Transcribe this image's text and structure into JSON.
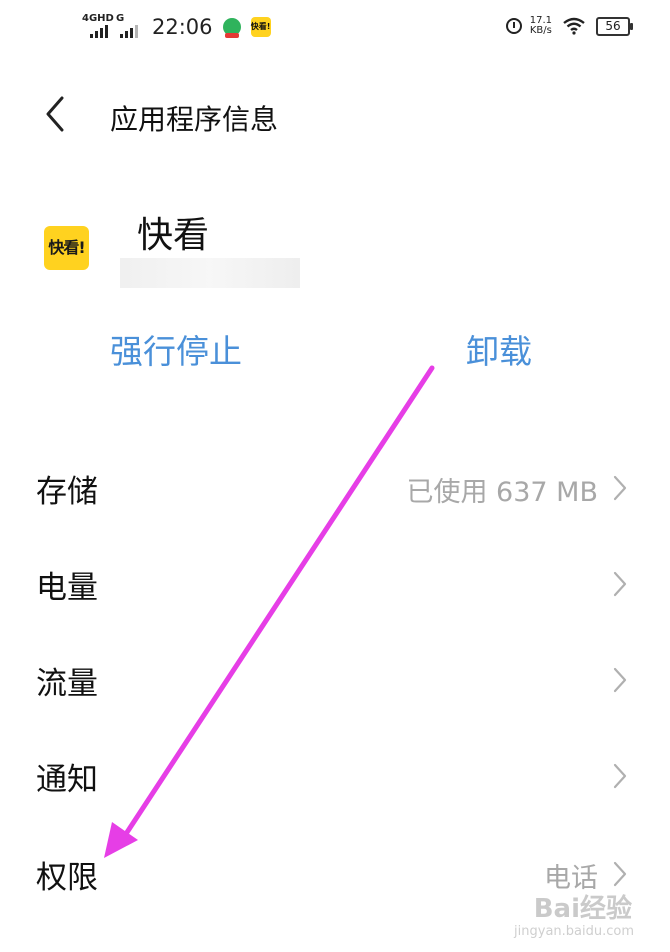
{
  "status_bar": {
    "network_1": "4GHD",
    "network_2": "G",
    "time": "22:06",
    "speed_value": "17.1",
    "speed_unit": "KB/s",
    "battery": "56"
  },
  "header": {
    "title": "应用程序信息"
  },
  "app": {
    "name": "快看",
    "icon_text": "快看!",
    "icon_color": "#ffd21f"
  },
  "actions": {
    "force_stop": "强行停止",
    "uninstall": "卸载",
    "accent_color": "#4a90d9"
  },
  "settings": [
    {
      "label": "存储",
      "value": "已使用 637 MB"
    },
    {
      "label": "电量",
      "value": ""
    },
    {
      "label": "流量",
      "value": ""
    },
    {
      "label": "通知",
      "value": ""
    },
    {
      "label": "权限",
      "value": "电话"
    }
  ],
  "annotation_arrow_color": "#e63ee6",
  "watermark": {
    "brand": "Bai经验",
    "url": "jingyan.baidu.com"
  }
}
